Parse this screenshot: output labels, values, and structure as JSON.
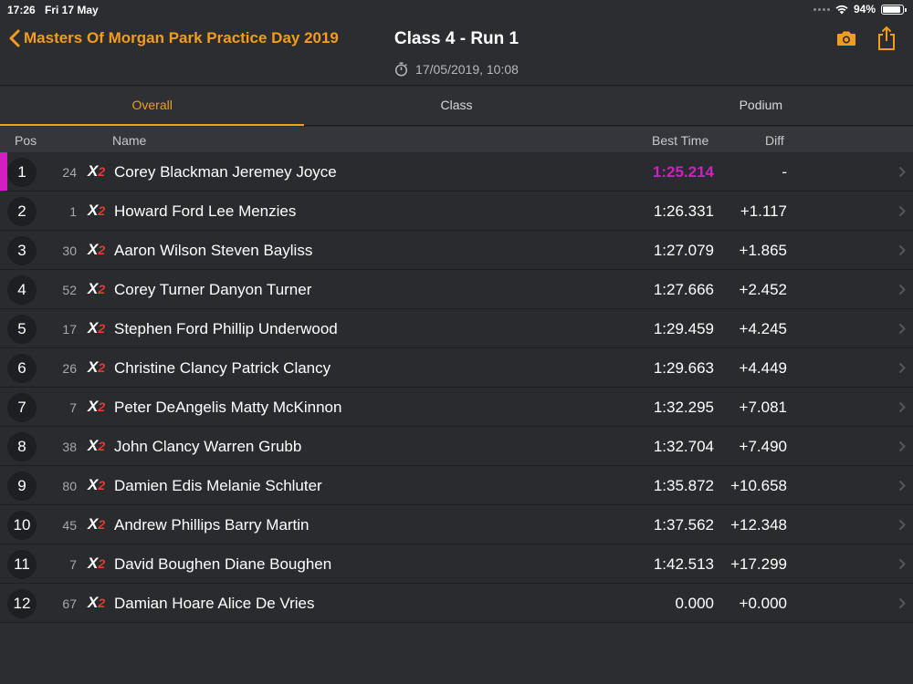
{
  "status_bar": {
    "time": "17:26",
    "date": "Fri 17 May",
    "battery": "94%"
  },
  "nav": {
    "back_label": "Masters Of Morgan Park Practice Day 2019",
    "title": "Class 4 - Run 1",
    "subtitle": "17/05/2019, 10:08",
    "camera_icon": "camera-icon",
    "share_icon": "share-icon"
  },
  "tabs": [
    {
      "label": "Overall",
      "active": true
    },
    {
      "label": "Class",
      "active": false
    },
    {
      "label": "Podium",
      "active": false
    }
  ],
  "columns": {
    "pos": "Pos",
    "name": "Name",
    "best_time": "Best Time",
    "diff": "Diff"
  },
  "rows": [
    {
      "pos": "1",
      "number": "24",
      "name": "Corey Blackman Jeremey Joyce",
      "best_time": "1:25.214",
      "diff": "-"
    },
    {
      "pos": "2",
      "number": "1",
      "name": "Howard Ford Lee Menzies",
      "best_time": "1:26.331",
      "diff": "+1.117"
    },
    {
      "pos": "3",
      "number": "30",
      "name": "Aaron Wilson Steven Bayliss",
      "best_time": "1:27.079",
      "diff": "+1.865"
    },
    {
      "pos": "4",
      "number": "52",
      "name": "Corey Turner Danyon Turner",
      "best_time": "1:27.666",
      "diff": "+2.452"
    },
    {
      "pos": "5",
      "number": "17",
      "name": "Stephen Ford Phillip Underwood",
      "best_time": "1:29.459",
      "diff": "+4.245"
    },
    {
      "pos": "6",
      "number": "26",
      "name": "Christine Clancy Patrick Clancy",
      "best_time": "1:29.663",
      "diff": "+4.449"
    },
    {
      "pos": "7",
      "number": "7",
      "name": "Peter DeAngelis Matty McKinnon",
      "best_time": "1:32.295",
      "diff": "+7.081"
    },
    {
      "pos": "8",
      "number": "38",
      "name": "John Clancy Warren Grubb",
      "best_time": "1:32.704",
      "diff": "+7.490"
    },
    {
      "pos": "9",
      "number": "80",
      "name": "Damien Edis Melanie Schluter",
      "best_time": "1:35.872",
      "diff": "+10.658"
    },
    {
      "pos": "10",
      "number": "45",
      "name": "Andrew Phillips Barry Martin",
      "best_time": "1:37.562",
      "diff": "+12.348"
    },
    {
      "pos": "11",
      "number": "7",
      "name": "David Boughen Diane Boughen",
      "best_time": "1:42.513",
      "diff": "+17.299"
    },
    {
      "pos": "12",
      "number": "67",
      "name": "Damian Hoare Alice De Vries",
      "best_time": "0.000",
      "diff": "+0.000"
    }
  ],
  "colors": {
    "accent": "#f39c1e",
    "fastest": "#d21fc4",
    "logo_red": "#e63a2e"
  }
}
